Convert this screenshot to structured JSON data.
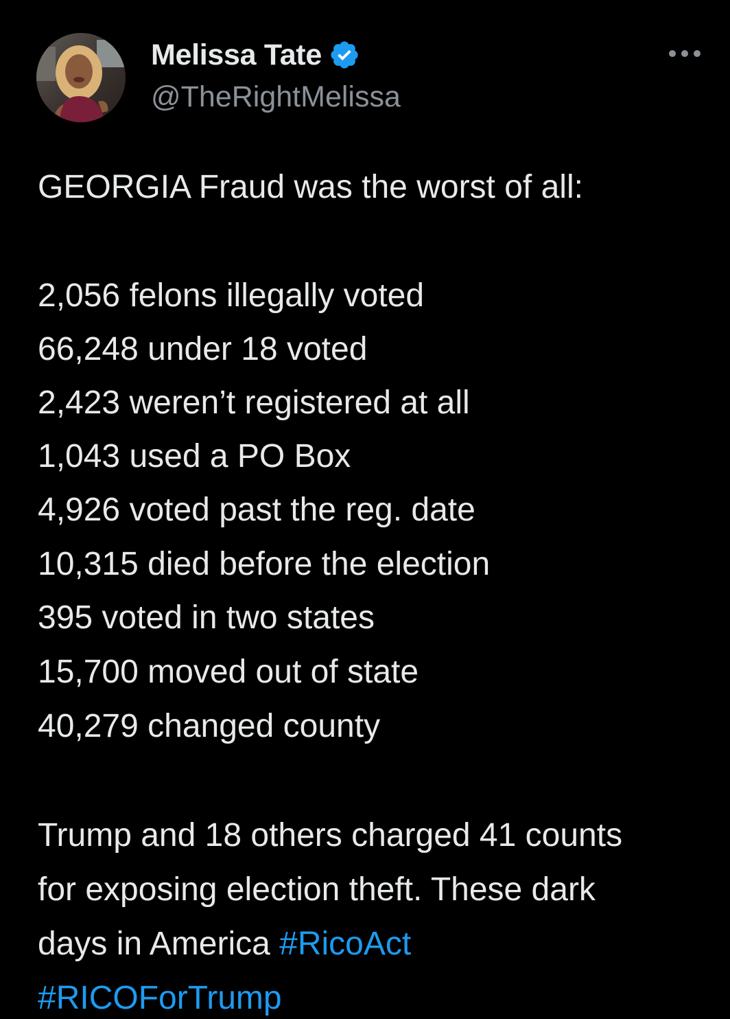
{
  "author": {
    "display_name": "Melissa Tate",
    "handle": "@TheRightMelissa",
    "verified": true,
    "verified_icon": "verified-badge-icon",
    "avatar_icon": "profile-photo",
    "more_icon": "more-options-icon"
  },
  "tweet": {
    "intro": "GEORGIA Fraud was the worst of all:",
    "stats": [
      "2,056 felons illegally voted",
      "66,248 under 18 voted",
      "2,423 weren’t registered at all",
      "1,043 used a PO Box",
      "4,926 voted past the reg. date",
      "10,315 died before the election",
      "395 voted in two states",
      "15,700 moved out of state",
      "40,279 changed county"
    ],
    "closing_lines": [
      "Trump and 18 others charged 41 counts",
      "for exposing election theft. These dark",
      "days in America "
    ],
    "hashtags": [
      "#RicoAct",
      "#RICOForTrump"
    ]
  },
  "colors": {
    "background": "#000000",
    "text": "#e7e9ea",
    "secondary_text": "#8b9198",
    "link": "#1d9bf0",
    "verified_badge": "#1d9bf0"
  }
}
